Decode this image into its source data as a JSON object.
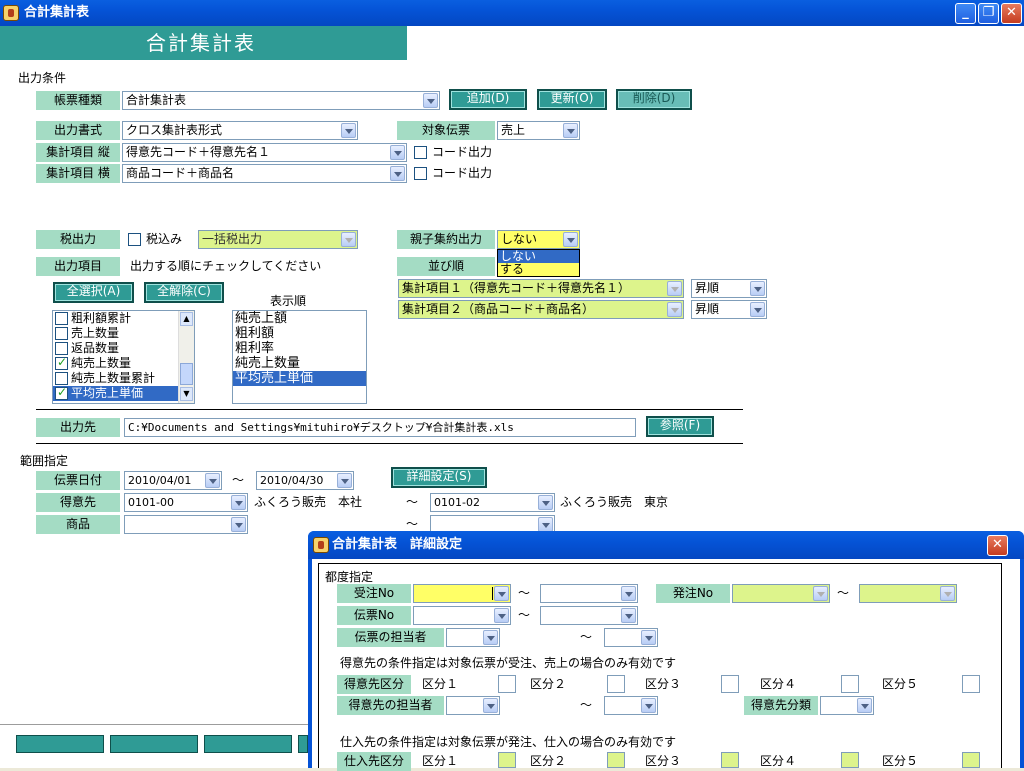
{
  "window": {
    "title": "合計集計表",
    "header": "合計集計表"
  },
  "output_conditions": {
    "section_label": "出力条件",
    "report_type": {
      "label": "帳票種類",
      "value": "合計集計表"
    },
    "buttons": {
      "add": "追加(D)",
      "update": "更新(O)",
      "delete": "削除(D)"
    },
    "output_format": {
      "label": "出力書式",
      "value": "クロス集計表形式"
    },
    "target_slip": {
      "label": "対象伝票",
      "value": "売上"
    },
    "agg_vertical": {
      "label": "集計項目 縦",
      "value": "得意先コード＋得意先名１",
      "checkbox": "コード出力"
    },
    "agg_horizontal": {
      "label": "集計項目 横",
      "value": "商品コード＋商品名",
      "checkbox": "コード出力"
    },
    "tax": {
      "label": "税出力",
      "checkbox": "税込み",
      "value": "一括税出力"
    },
    "parent_child": {
      "label": "親子集約出力",
      "value": "しない",
      "options": [
        "しない",
        "する"
      ]
    },
    "output_items": {
      "label": "出力項目",
      "hint": "出力する順にチェックしてください"
    },
    "sort": {
      "label": "並び順"
    },
    "select_all": "全選択(A)",
    "deselect_all": "全解除(C)",
    "display_order_label": "表示順",
    "items_list": [
      {
        "label": "粗利額累計",
        "checked": false
      },
      {
        "label": "売上数量",
        "checked": false
      },
      {
        "label": "返品数量",
        "checked": false
      },
      {
        "label": "純売上数量",
        "checked": true
      },
      {
        "label": "純売上数量累計",
        "checked": false
      },
      {
        "label": "平均売上単価",
        "checked": true
      }
    ],
    "display_list": [
      "純売上額",
      "粗利額",
      "粗利率",
      "純売上数量",
      "平均売上単価"
    ],
    "sort1": {
      "value": "集計項目１（得意先コード＋得意先名１）",
      "order": "昇順"
    },
    "sort2": {
      "value": "集計項目２（商品コード＋商品名）",
      "order": "昇順"
    },
    "destination": {
      "label": "出力先",
      "value": "C:¥Documents and Settings¥mituhiro¥デスクトップ¥合計集計表.xls",
      "browse": "参照(F)"
    }
  },
  "range": {
    "section_label": "範囲指定",
    "slip_date": {
      "label": "伝票日付",
      "from": "2010/04/01",
      "to": "2010/04/30"
    },
    "detail_button": "詳細設定(S)",
    "customer": {
      "label": "得意先",
      "from": "0101-00",
      "from_name": "ふくろう販売　本社",
      "to": "0101-02",
      "to_name": "ふくろう販売　東京"
    },
    "product": {
      "label": "商品"
    },
    "tilde": "～"
  },
  "dialog": {
    "title": "合計集計表　詳細設定",
    "section": "都度指定",
    "order_no": {
      "label": "受注No"
    },
    "purchase_order_no": {
      "label": "発注No"
    },
    "slip_no": {
      "label": "伝票No"
    },
    "slip_staff": {
      "label": "伝票の担当者"
    },
    "customer_note": "得意先の条件指定は対象伝票が受注、売上の場合のみ有効です",
    "customer_class": {
      "label": "得意先区分",
      "k1": "区分１",
      "k2": "区分２",
      "k3": "区分３",
      "k4": "区分４",
      "k5": "区分５"
    },
    "customer_staff": {
      "label": "得意先の担当者"
    },
    "customer_category": {
      "label": "得意先分類"
    },
    "supplier_note": "仕入先の条件指定は対象伝票が発注、仕入の場合のみ有効です",
    "supplier_class": {
      "label": "仕入先区分",
      "k1": "区分１",
      "k2": "区分２",
      "k3": "区分３",
      "k4": "区分４",
      "k5": "区分５"
    }
  },
  "colors": {
    "teal": "#2f9b95",
    "label_bg": "#a4dcc4",
    "yellow": "#ffff66",
    "lime": "#ddf48c",
    "selection": "#316ac5"
  }
}
